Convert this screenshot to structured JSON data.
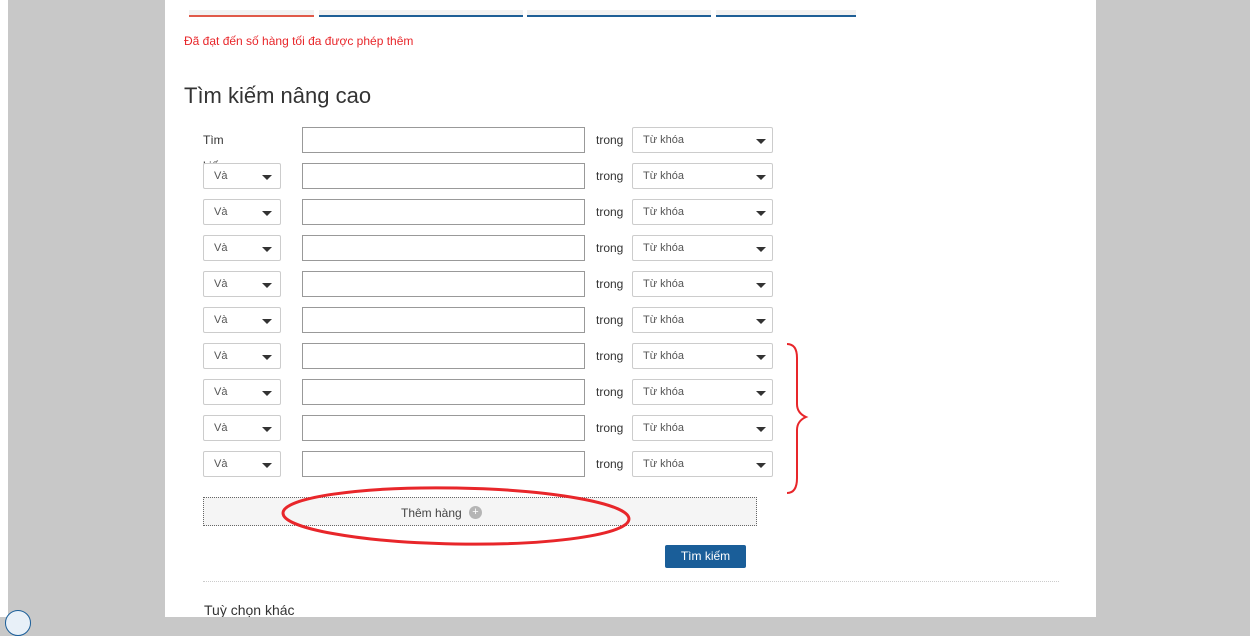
{
  "message": {
    "error": "Đã đạt đến số hàng tối đa được phép thêm"
  },
  "page": {
    "title": "Tìm kiếm nâng cao"
  },
  "form": {
    "first_label": "Tìm kiếm",
    "operator_value": "Và",
    "in_label": "trong",
    "field_value": "Từ khóa",
    "add_row_label": "Thêm hàng",
    "search_button": "Tìm kiếm"
  },
  "sections": {
    "other_options": "Tuỳ chọn khác"
  },
  "annotation": {
    "highlight_color": "#e8262a"
  },
  "icons": [
    "plus-circle-icon",
    "chevron-down-icon"
  ]
}
